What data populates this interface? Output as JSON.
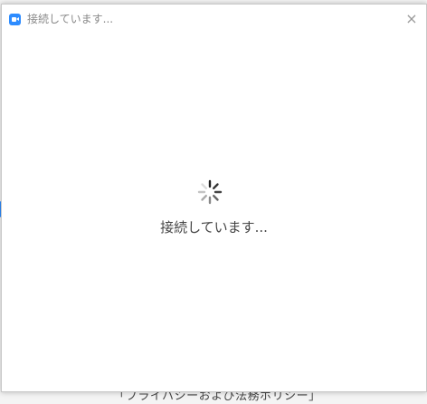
{
  "window": {
    "title": "接続しています...",
    "close_glyph": "×"
  },
  "main": {
    "status": "接続しています..."
  },
  "background": {
    "footer_text": "「プライバシーおよび法務ポリシー」"
  },
  "icons": {
    "app": "zoom-camera-icon",
    "close": "close-icon",
    "spinner": "loading-spinner-icon"
  },
  "colors": {
    "accent": "#2d8cff",
    "title_text": "#888888",
    "status_text": "#444444"
  }
}
